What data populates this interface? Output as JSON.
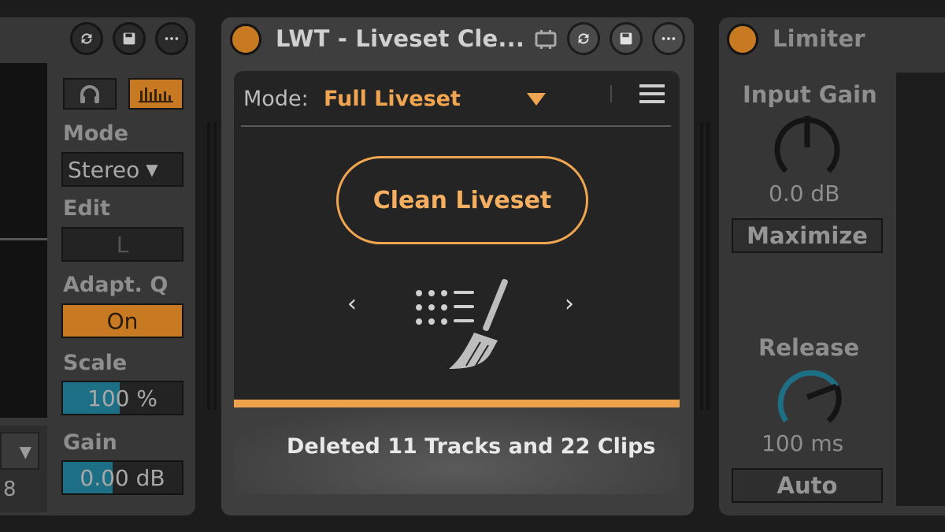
{
  "left_device": {
    "labels": {
      "mode": "Mode",
      "edit": "Edit",
      "adapt_q": "Adapt. Q",
      "scale": "Scale",
      "gain": "Gain"
    },
    "values": {
      "mode": "Stereo",
      "edit": "L",
      "adapt_q": "On",
      "scale": "100 %",
      "gain": "0.00 dB",
      "lower_number": "8"
    },
    "scale_fill_fraction": 0.48,
    "gain_fill_fraction": 0.42,
    "icons": [
      "refresh-icon",
      "save-icon",
      "more-icon",
      "headphones-icon",
      "spectrum-icon",
      "dropdown-arrow-icon"
    ]
  },
  "center_device": {
    "title": "LWT - Liveset Cle...",
    "mode_label": "Mode:",
    "mode_value": "Full Liveset",
    "clean_button": "Clean Liveset",
    "nav_prev": "‹",
    "nav_next": "›",
    "status": "Deleted 11 Tracks and 22 Clips",
    "progress": 1.0,
    "icons": [
      "power-icon",
      "midi-map-icon",
      "refresh-icon",
      "save-icon",
      "more-icon",
      "dropdown-triangle-icon",
      "menu-icon",
      "broom-clean-icon"
    ]
  },
  "right_device": {
    "title": "Limiter",
    "input_gain_label": "Input Gain",
    "input_gain_value": "0.0 dB",
    "maximize_label": "Maximize",
    "release_label": "Release",
    "release_value": "100 ms",
    "auto_label": "Auto",
    "icons": [
      "power-icon",
      "input-gain-knob-icon",
      "release-knob-icon"
    ]
  },
  "colors": {
    "accent": "#efa24c",
    "teal": "#1d6f86",
    "background": "#1c1c1c"
  }
}
